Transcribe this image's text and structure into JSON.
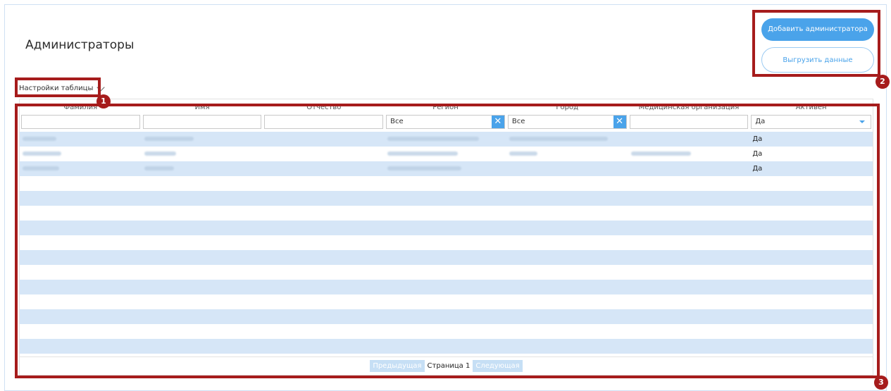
{
  "page": {
    "title": "Администраторы"
  },
  "settings": {
    "label": "Настройки таблицы"
  },
  "actions": {
    "add_admin": "Добавить администратора",
    "export": "Выгрузить данные"
  },
  "annotations": [
    "1",
    "2",
    "3"
  ],
  "table": {
    "columns": [
      "Фамилия",
      "Имя",
      "Отчество",
      "Регион",
      "Город",
      "Медицинская организация",
      "Активен"
    ],
    "filters": {
      "region": "Все",
      "city": "Все",
      "active": "Да"
    },
    "rows": [
      {
        "active": "Да"
      },
      {
        "active": "Да"
      },
      {
        "active": "Да"
      }
    ]
  },
  "pager": {
    "prev": "Предыдущая",
    "page": "Страница 1",
    "next": "Следующая"
  }
}
